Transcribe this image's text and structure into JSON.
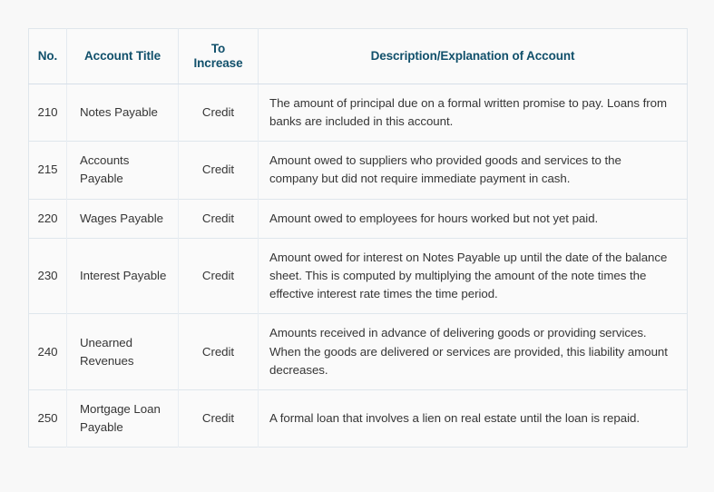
{
  "table": {
    "columns": [
      {
        "key": "no",
        "label": "No."
      },
      {
        "key": "title",
        "label": "Account Title"
      },
      {
        "key": "increase",
        "label_line1": "To",
        "label_line2": "Increase"
      },
      {
        "key": "desc",
        "label": "Description/Explanation of Account"
      }
    ],
    "header_text_color": "#11506b",
    "body_text_color": "#363636",
    "border_color": "#dfe6ec",
    "row_background": "#fafafa",
    "rows": [
      {
        "no": "210",
        "title": "Notes Payable",
        "increase": "Credit",
        "desc": "The amount of principal due on a formal written promise to pay. Loans from banks are included in this account."
      },
      {
        "no": "215",
        "title": "Accounts Payable",
        "increase": "Credit",
        "desc": "Amount owed to suppliers who provided goods and services to the company but did not require immediate payment in cash."
      },
      {
        "no": "220",
        "title": "Wages Payable",
        "increase": "Credit",
        "desc": "Amount owed to employees for hours worked but not yet paid."
      },
      {
        "no": "230",
        "title": "Interest Payable",
        "increase": "Credit",
        "desc": "Amount owed for interest on Notes Payable up until the date of the balance sheet. This is computed by multiplying the amount of the note times the effective interest rate times the time period."
      },
      {
        "no": "240",
        "title": "Unearned Revenues",
        "increase": "Credit",
        "desc": "Amounts received in advance of delivering goods or providing services. When the goods are delivered or services are provided, this liability amount decreases."
      },
      {
        "no": "250",
        "title": "Mortgage Loan Payable",
        "increase": "Credit",
        "desc": "A formal loan that involves a lien on real estate until the loan is repaid."
      }
    ]
  }
}
